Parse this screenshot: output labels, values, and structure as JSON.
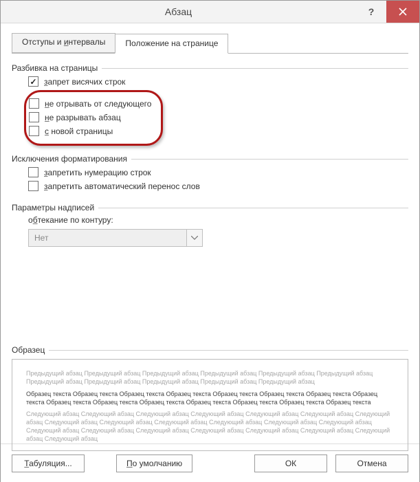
{
  "title": "Абзац",
  "tabs": {
    "indent": {
      "pre": "Отступы и ",
      "u": "и",
      "post": "нтервалы",
      "full": "Отступы и интервалы"
    },
    "position": "Положение на странице"
  },
  "groups": {
    "pagination": {
      "title": "Разбивка на страницы",
      "widow": {
        "pre": "",
        "u": "з",
        "post": "апрет висячих строк"
      },
      "keep_next": {
        "pre": "",
        "u": "н",
        "post": "е отрывать от следующего"
      },
      "keep_lines": {
        "pre": "",
        "u": "н",
        "post": "е разрывать абзац"
      },
      "page_break": {
        "pre": "",
        "u": "с",
        "post": " новой страницы"
      }
    },
    "formatting_exceptions": {
      "title": "Исключения форматирования",
      "suppress_numbers": {
        "pre": "",
        "u": "з",
        "post": "апретить нумерацию строк"
      },
      "no_hyphen": {
        "pre": "",
        "u": "з",
        "post": "апретить автоматический перенос слов"
      }
    },
    "textbox": {
      "title": "Параметры надписей",
      "wrap_label": {
        "pre": "о",
        "u": "б",
        "post": "текание по контуру:"
      },
      "wrap_value": "Нет"
    },
    "preview": {
      "title": "Образец",
      "prev": "Предыдущий абзац Предыдущий абзац Предыдущий абзац Предыдущий абзац Предыдущий абзац Предыдущий абзац Предыдущий абзац Предыдущий абзац Предыдущий абзац Предыдущий абзац Предыдущий абзац",
      "sample": "Образец текста Образец текста Образец текста Образец текста Образец текста Образец текста Образец текста Образец текста Образец текста Образец текста Образец текста Образец текста Образец текста Образец текста Образец текста",
      "next": "Следующий абзац Следующий абзац Следующий абзац Следующий абзац Следующий абзац Следующий абзац Следующий абзац Следующий абзац Следующий абзац Следующий абзац Следующий абзац Следующий абзац Следующий абзац Следующий абзац Следующий абзац Следующий абзац Следующий абзац Следующий абзац Следующий абзац Следующий абзац Следующий абзац"
    }
  },
  "buttons": {
    "tabs": {
      "pre": "",
      "u": "Т",
      "post": "абуляция..."
    },
    "default": {
      "pre": "",
      "u": "П",
      "post": "о умолчанию"
    },
    "ok": "ОК",
    "cancel": "Отмена"
  }
}
